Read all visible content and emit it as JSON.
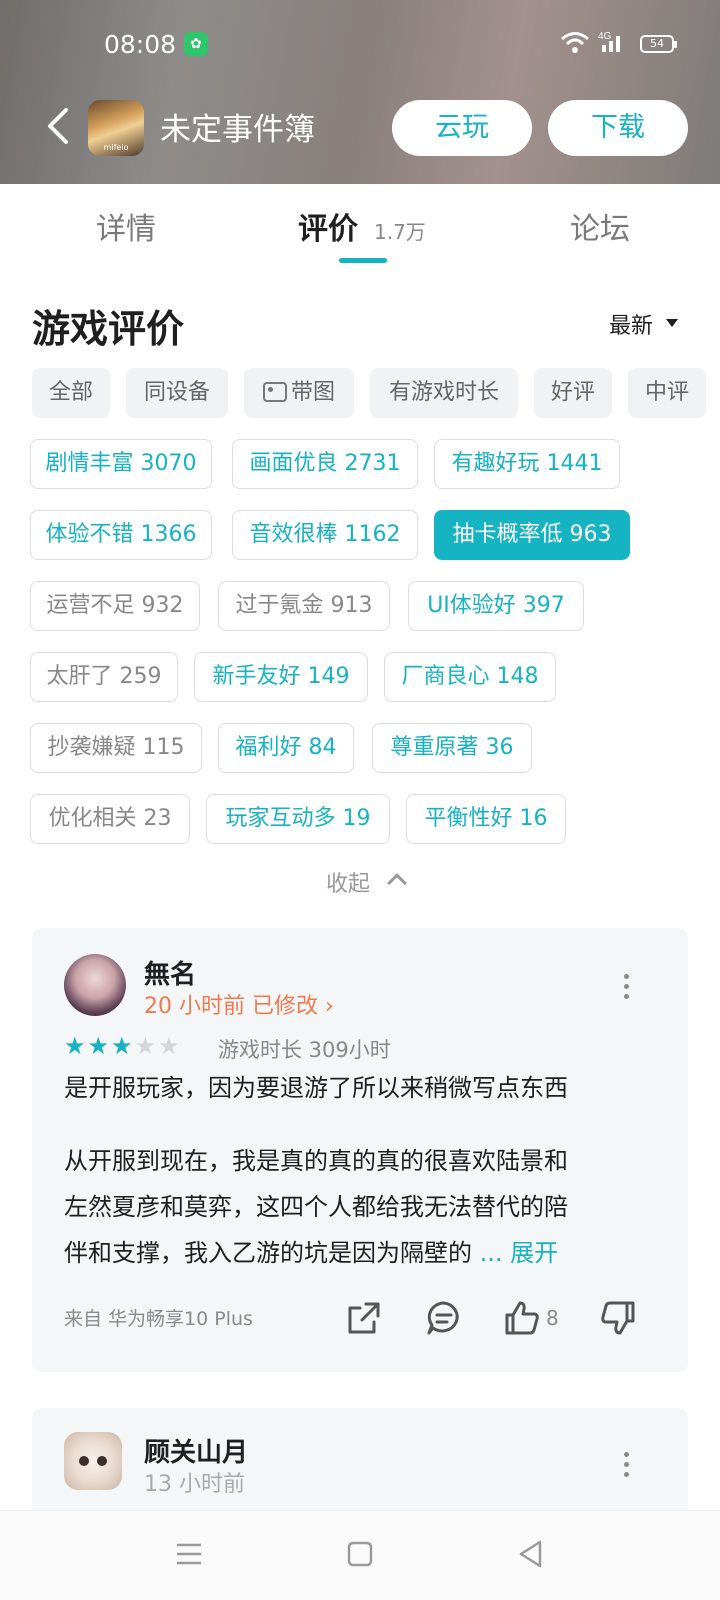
{
  "status_bar": {
    "time": "08:08",
    "battery": "54",
    "network": "4G"
  },
  "header": {
    "game_title": "未定事件簿",
    "icon_caption": "mifeio",
    "cloud_play_label": "云玩",
    "download_label": "下载"
  },
  "tabs": {
    "details": "详情",
    "reviews": "评价",
    "reviews_count": "1.7万",
    "forum": "论坛"
  },
  "section": {
    "title": "游戏评价",
    "sort_label": "最新"
  },
  "filters": [
    "全部",
    "同设备",
    "带图",
    "有游戏时长",
    "好评",
    "中评"
  ],
  "tags": [
    "剧情丰富 3070",
    "画面优良 2731",
    "有趣好玩 1441",
    "体验不错 1366",
    "音效很棒 1162",
    "抽卡概率低 963",
    "运营不足 932",
    "过于氪金 913",
    "UI体验好  397",
    "太肝了 259",
    "新手友好 149",
    "厂商良心 148",
    "抄袭嫌疑 115",
    "福利好 84",
    "尊重原著 36",
    "优化相关 23",
    "玩家互动多 19",
    "平衡性好 16"
  ],
  "collapse_label": "收起",
  "reviews": [
    {
      "username": "無名",
      "time": "20 小时前 已修改",
      "stars_filled": 3,
      "stars_total": 5,
      "playtime": "游戏时长 309小时",
      "first_line": "是开服玩家，因为要退游了所以来稍微写点东西",
      "body_lines": [
        "从开服到现在，我是真的真的真的很喜欢陆景和",
        "左然夏彦和莫弈，这四个人都给我无法替代的陪",
        "伴和支撑，我入乙游的坑是因为隔壁的"
      ],
      "expand_label": "... 展开",
      "source": "来自 华为畅享10 Plus",
      "likes": "8"
    },
    {
      "username": "顾关山月",
      "time": "13 小时前"
    }
  ],
  "colors": {
    "accent": "#16b3c2",
    "orange": "#ef7b4d"
  }
}
